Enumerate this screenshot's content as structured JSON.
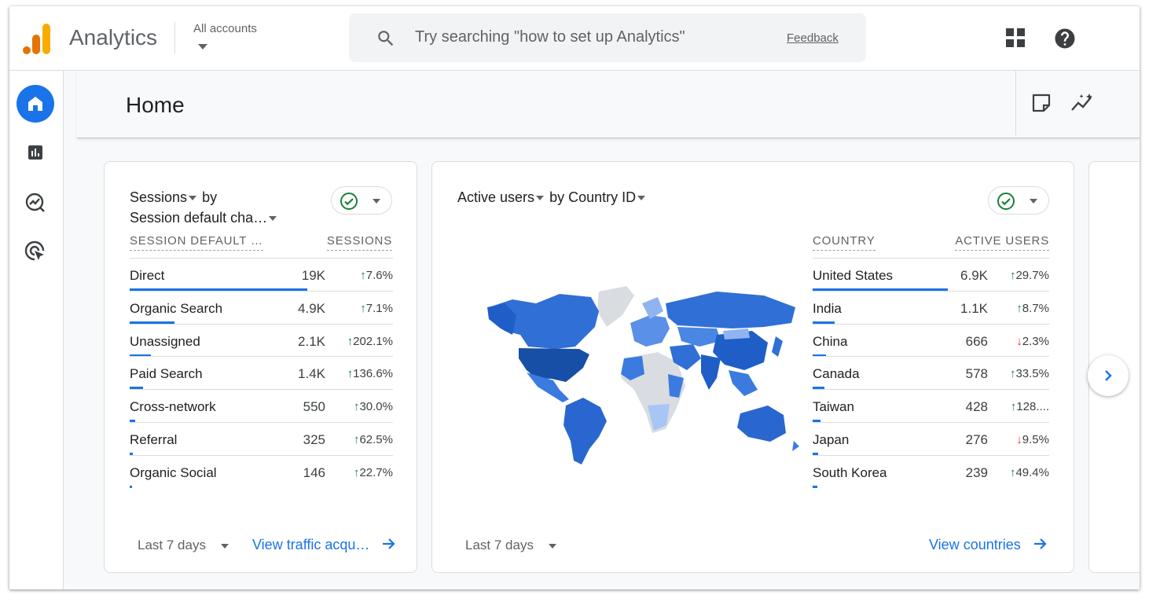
{
  "app": {
    "title": "Analytics",
    "accounts_label": "All accounts",
    "search_placeholder": "Try searching \"how to set up Analytics\"",
    "feedback_label": "Feedback"
  },
  "page": {
    "title": "Home"
  },
  "colors": {
    "accent": "#1a73e8",
    "up": "#188038",
    "down": "#d93025",
    "logo_orange": "#f9ab00",
    "logo_dark": "#e37400"
  },
  "icons": [
    "bar-chart-logo-icon",
    "search-icon",
    "apps-grid-icon",
    "help-icon",
    "home-icon",
    "reports-icon",
    "explore-icon",
    "advertising-icon",
    "note-icon",
    "insights-icon",
    "check-circle-icon",
    "arrow-right-icon",
    "chevron-right-icon"
  ],
  "sessions_card": {
    "title_metric": "Sessions",
    "title_by": "by",
    "title_dimension": "Session default cha…",
    "col_dimension": "SESSION DEFAULT …",
    "col_metric": "SESSIONS",
    "rows": [
      {
        "label": "Direct",
        "value": "19K",
        "change": "7.6%",
        "dir": "up",
        "share": 0.67
      },
      {
        "label": "Organic Search",
        "value": "4.9K",
        "change": "7.1%",
        "dir": "up",
        "share": 0.17
      },
      {
        "label": "Unassigned",
        "value": "2.1K",
        "change": "202.1%",
        "dir": "up",
        "share": 0.08
      },
      {
        "label": "Paid Search",
        "value": "1.4K",
        "change": "136.6%",
        "dir": "up",
        "share": 0.05
      },
      {
        "label": "Cross-network",
        "value": "550",
        "change": "30.0%",
        "dir": "up",
        "share": 0.02
      },
      {
        "label": "Referral",
        "value": "325",
        "change": "62.5%",
        "dir": "up",
        "share": 0.012
      },
      {
        "label": "Organic Social",
        "value": "146",
        "change": "22.7%",
        "dir": "up",
        "share": 0.006
      }
    ],
    "date_range": "Last 7 days",
    "link": "View traffic acqu…"
  },
  "users_card": {
    "title_metric": "Active users",
    "title_by": "by",
    "title_dimension": "Country ID",
    "col_dimension": "COUNTRY",
    "col_metric": "ACTIVE USERS",
    "rows": [
      {
        "label": "United States",
        "value": "6.9K",
        "change": "29.7%",
        "dir": "up",
        "share": 1.0
      },
      {
        "label": "India",
        "value": "1.1K",
        "change": "8.7%",
        "dir": "up",
        "share": 0.16
      },
      {
        "label": "China",
        "value": "666",
        "change": "2.3%",
        "dir": "down",
        "share": 0.1
      },
      {
        "label": "Canada",
        "value": "578",
        "change": "33.5%",
        "dir": "up",
        "share": 0.085
      },
      {
        "label": "Taiwan",
        "value": "428",
        "change": "128....",
        "dir": "up",
        "share": 0.06
      },
      {
        "label": "Japan",
        "value": "276",
        "change": "9.5%",
        "dir": "down",
        "share": 0.04
      },
      {
        "label": "South Korea",
        "value": "239",
        "change": "49.4%",
        "dir": "up",
        "share": 0.035
      }
    ],
    "date_range": "Last 7 days",
    "link": "View countries"
  }
}
